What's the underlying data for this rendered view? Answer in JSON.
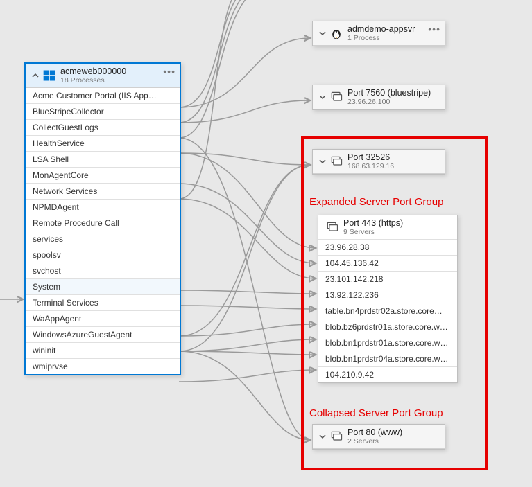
{
  "main_node": {
    "title": "acmeweb000000",
    "subtitle": "18 Processes",
    "processes": [
      "Acme Customer Portal (IIS App…",
      "BlueStripeCollector",
      "CollectGuestLogs",
      "HealthService",
      "LSA Shell",
      "MonAgentCore",
      "Network Services",
      "NPMDAgent",
      "Remote Procedure Call",
      "services",
      "spoolsv",
      "svchost",
      "System",
      "Terminal Services",
      "WaAppAgent",
      "WindowsAzureGuestAgent",
      "wininit",
      "wmiprvse"
    ],
    "highlighted_index": 12
  },
  "target_nodes": {
    "appsvr": {
      "title": "admdemo-appsvr",
      "subtitle": "1 Process"
    },
    "port7560": {
      "title": "Port 7560 (bluestripe)",
      "subtitle": "23.96.26.100"
    },
    "port32526": {
      "title": "Port 32526",
      "subtitle": "168.63.129.16"
    },
    "port443": {
      "title": "Port 443 (https)",
      "subtitle": "9 Servers",
      "servers": [
        "23.96.28.38",
        "104.45.136.42",
        "23.101.142.218",
        "13.92.122.236",
        "table.bn4prdstr02a.store.core…",
        "blob.bz6prdstr01a.store.core.w…",
        "blob.bn1prdstr01a.store.core.w…",
        "blob.bn1prdstr04a.store.core.w…",
        "104.210.9.42"
      ]
    },
    "port80": {
      "title": "Port 80 (www)",
      "subtitle": "2 Servers"
    }
  },
  "annotations": {
    "expanded_label": "Expanded Server Port Group",
    "collapsed_label": "Collapsed Server Port Group"
  }
}
